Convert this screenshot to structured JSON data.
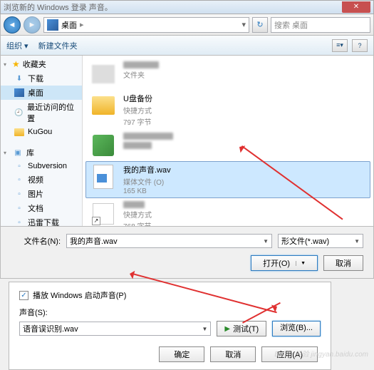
{
  "title": "浏览新的 Windows 登录 声音。",
  "breadcrumb": {
    "location": "桌面"
  },
  "search_placeholder": "搜索 桌面",
  "toolbar": {
    "organize": "组织 ▾",
    "new_folder": "新建文件夹"
  },
  "sidebar": {
    "favorites": "收藏夹",
    "items_fav": [
      {
        "label": "下载"
      },
      {
        "label": "桌面"
      },
      {
        "label": "最近访问的位置"
      },
      {
        "label": "KuGou"
      }
    ],
    "library": "库",
    "items_lib": [
      {
        "label": "Subversion"
      },
      {
        "label": "视频"
      },
      {
        "label": "图片"
      },
      {
        "label": "文档"
      },
      {
        "label": "迅雷下载"
      }
    ]
  },
  "files": [
    {
      "name": "",
      "meta": "文件夹"
    },
    {
      "name": "U盘备份",
      "meta1": "快捷方式",
      "meta2": "797 字节"
    },
    {
      "name": "",
      "meta": ""
    },
    {
      "name": "我的声音.wav",
      "meta1": "媒体文件 (O)",
      "meta2": "165 KB"
    },
    {
      "name": "",
      "meta1": "快捷方式",
      "meta2": "768 字节"
    }
  ],
  "filename": {
    "label": "文件名(N):",
    "value": "我的声音.wav",
    "filter": "形文件(*.wav)"
  },
  "buttons": {
    "open": "打开(O)",
    "cancel": "取消"
  },
  "sound_dialog": {
    "play_checkbox": "播放 Windows 启动声音(P)",
    "sound_label": "声音(S):",
    "current_sound": "语音误识别.wav",
    "test": "测试(T)",
    "browse": "浏览(B)...",
    "ok": "确定",
    "cancel2": "取消",
    "apply": "应用(A)"
  },
  "watermark": "Baidu 经验 jingyan.baidu.com"
}
